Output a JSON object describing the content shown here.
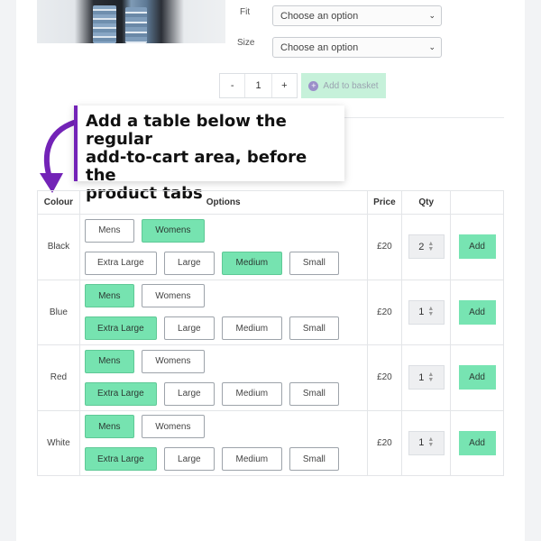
{
  "variation_form": {
    "fit_label": "Fit",
    "fit_value": "Choose an option",
    "size_label": "Size",
    "size_value": "Choose an option",
    "qty_minus": "-",
    "qty_value": "1",
    "qty_plus": "+",
    "basket_label": "Add to basket"
  },
  "callout": {
    "line1": "Add a table below the regular",
    "line2": "add-to-cart  area, before the",
    "line3": "product tabs"
  },
  "table": {
    "headers": [
      "Colour",
      "Options",
      "Price",
      "Qty",
      ""
    ],
    "fit_options": [
      "Mens",
      "Womens"
    ],
    "size_options": [
      "Extra Large",
      "Large",
      "Medium",
      "Small"
    ],
    "rows": [
      {
        "colour": "Black",
        "price": "£20",
        "qty": "2",
        "add": "Add",
        "fit_selected": "Womens",
        "size_selected": "Medium"
      },
      {
        "colour": "Blue",
        "price": "£20",
        "qty": "1",
        "add": "Add",
        "fit_selected": "Mens",
        "size_selected": "Extra Large"
      },
      {
        "colour": "Red",
        "price": "£20",
        "qty": "1",
        "add": "Add",
        "fit_selected": "Mens",
        "size_selected": "Extra Large"
      },
      {
        "colour": "White",
        "price": "£20",
        "qty": "1",
        "add": "Add",
        "fit_selected": "Mens",
        "size_selected": "Extra Large"
      }
    ]
  },
  "colors": {
    "accent_green": "#76e3b0",
    "callout_purple": "#7323b7"
  },
  "icons": [
    "chevron-down-icon",
    "plus-circle-icon",
    "curved-arrow-icon",
    "spinner-arrows-icon"
  ]
}
